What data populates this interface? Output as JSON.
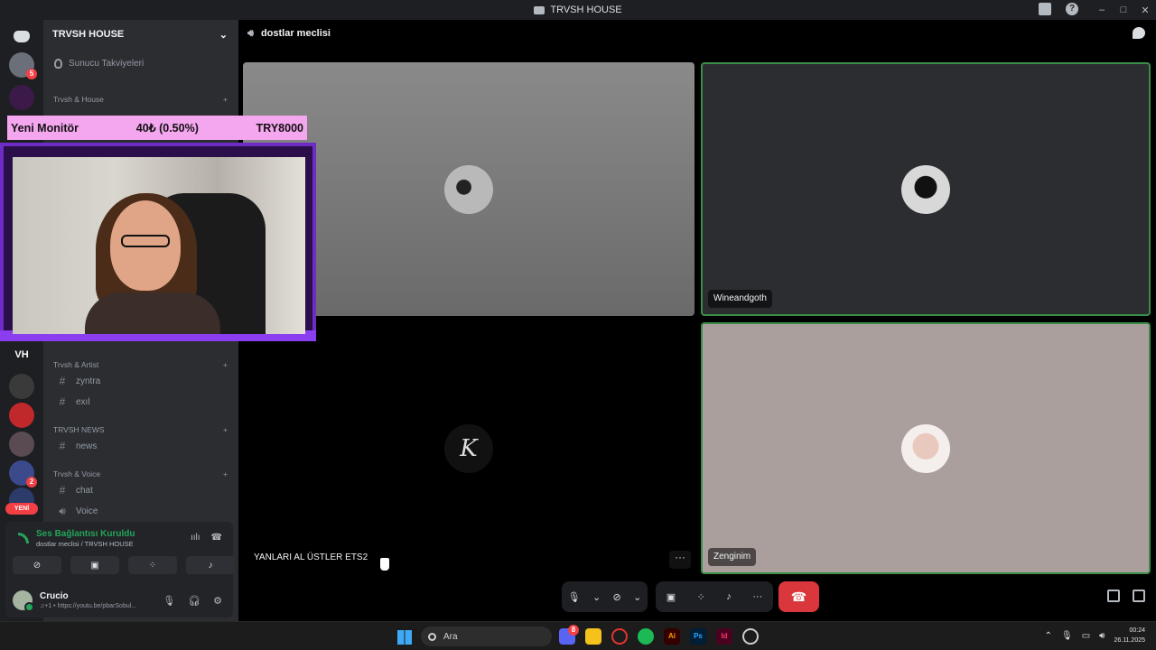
{
  "window": {
    "title": "TRVSH HOUSE",
    "controls": [
      "–",
      "□",
      "✕"
    ]
  },
  "rail": {
    "badges": [
      "5",
      "2"
    ],
    "server_initials": "VH",
    "new_label": "YENİ"
  },
  "sidebar": {
    "server_name": "TRVSH HOUSE",
    "boost_label": "Sunucu Takviyeleri",
    "categories": [
      {
        "name": "Trvsh & House"
      },
      {
        "name": "Trvsh & Artist"
      },
      {
        "name": "TRVSH NEWS"
      },
      {
        "name": "Trvsh & Voice"
      }
    ],
    "channels": [
      {
        "name": "zyntra"
      },
      {
        "name": "exıl"
      },
      {
        "name": "news"
      },
      {
        "name": "chat"
      },
      {
        "name": "Voice"
      }
    ]
  },
  "overlay": {
    "title": "Yeni Monitör",
    "amount": "40₺ (0.50%)",
    "goal": "TRY8000"
  },
  "voice_panel": {
    "status": "Ses Bağlantısı Kuruldu",
    "location": "dostlar meclisi / TRVSH HOUSE"
  },
  "user": {
    "name": "Crucio",
    "status": "♫+1 • https://youtu.be/pbarSobul..."
  },
  "main": {
    "channel_title": "dostlar meclisi",
    "tiles": [
      {
        "name": ""
      },
      {
        "name": "Wineandgoth"
      },
      {
        "name": "YANLARI AL ÜSTLER ETS2",
        "avatar_letter": "K"
      },
      {
        "name": "Zenginim"
      }
    ],
    "more_label": "···"
  },
  "taskbar": {
    "search_placeholder": "Ara",
    "time": "00:24",
    "date": "26.11.2025",
    "discord_badge": "8"
  }
}
